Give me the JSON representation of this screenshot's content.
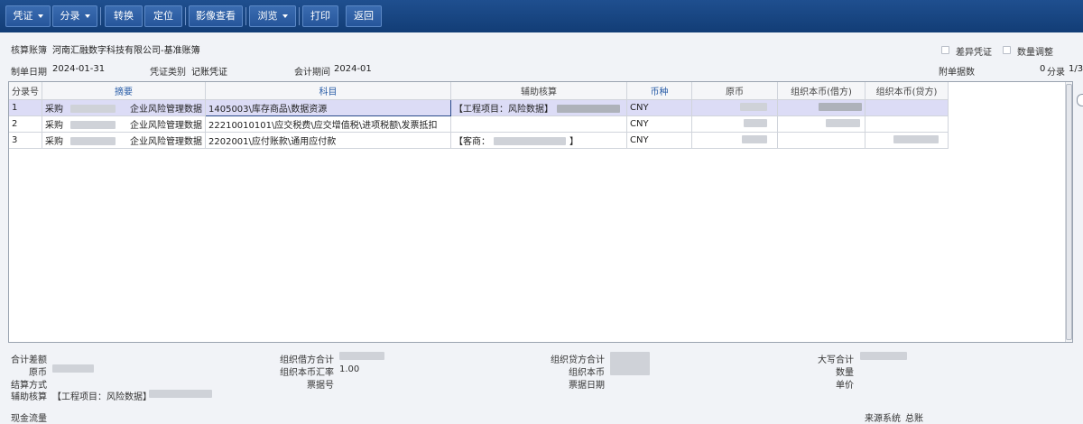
{
  "toolbar": {
    "voucher": "凭证",
    "entry": "分录",
    "convert": "转换",
    "locate": "定位",
    "image_view": "影像查看",
    "browse": "浏览",
    "print": "打印",
    "back": "返回"
  },
  "header": {
    "ledger_label": "核算账簿",
    "ledger_value": "河南汇融数字科技有限公司-基准账簿",
    "diff_voucher_label": "差异凭证",
    "qty_adjust_label": "数量调整",
    "date_label": "制单日期",
    "date_value": "2024-01-31",
    "type_label": "凭证类别",
    "type_value": "记账凭证",
    "period_label": "会计期间",
    "period_value": "2024-01",
    "attach_label": "附单据数",
    "entry_count_value": "0",
    "entry_count_label": "分录",
    "entry_page": "1/3"
  },
  "grid": {
    "columns": [
      "分录号",
      "摘要",
      "科目",
      "辅助核算",
      "币种",
      "原币",
      "组织本币(借方)",
      "组织本币(贷方)"
    ],
    "rows": [
      {
        "no": "1",
        "summary_prefix": "采购",
        "summary_suffix": "企业风险管理数据",
        "subject": "1405003\\库存商品\\数据资源",
        "aux": "【工程项目：风险数据】",
        "currency": "CNY"
      },
      {
        "no": "2",
        "summary_prefix": "采购",
        "summary_suffix": "企业风险管理数据",
        "subject": "22210010101\\应交税费\\应交增值税\\进项税额\\发票抵扣",
        "aux": "",
        "currency": "CNY"
      },
      {
        "no": "3",
        "summary_prefix": "采购",
        "summary_suffix": "企业风险管理数据",
        "subject": "2202001\\应付账款\\通用应付款",
        "aux_prefix": "【客商：",
        "aux_suffix": "】",
        "currency": "CNY"
      }
    ]
  },
  "footer": {
    "total_diff": "合计差额",
    "orig_currency": "原币",
    "settle_method": "结算方式",
    "aux_label": "辅助核算",
    "aux_value": "【工程项目：风险数据】",
    "cash_flow": "现金流量",
    "debit_total": "组织借方合计",
    "rate_label": "组织本币汇率",
    "rate_value": "1.00",
    "bill_no": "票据号",
    "credit_total": "组织贷方合计",
    "org_currency": "组织本币",
    "bill_date": "票据日期",
    "uppercase_total": "大写合计",
    "quantity": "数量",
    "unit_price": "单价",
    "source_label": "来源系统",
    "source_value": "总账"
  }
}
